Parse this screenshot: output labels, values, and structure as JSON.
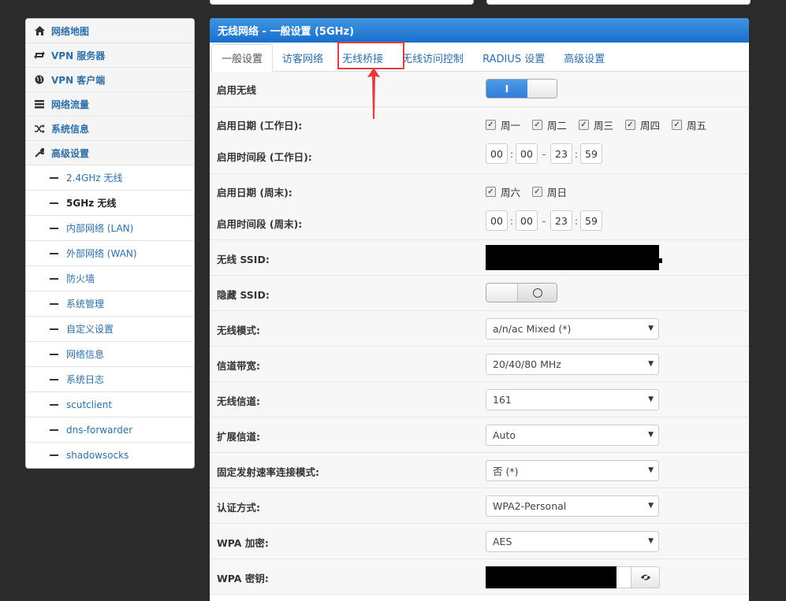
{
  "sidebar": {
    "items": [
      {
        "label": "网络地图",
        "icon": "home-icon"
      },
      {
        "label": "VPN 服务器",
        "icon": "vpn-server-icon"
      },
      {
        "label": "VPN 客户端",
        "icon": "globe-icon"
      },
      {
        "label": "网络流量",
        "icon": "list-icon"
      },
      {
        "label": "系统信息",
        "icon": "shuffle-icon"
      },
      {
        "label": "高级设置",
        "icon": "wrench-icon"
      }
    ],
    "subitems": [
      {
        "label": "2.4GHz 无线"
      },
      {
        "label": "5GHz 无线"
      },
      {
        "label": "内部网络 (LAN)"
      },
      {
        "label": "外部网络 (WAN)"
      },
      {
        "label": "防火墙"
      },
      {
        "label": "系统管理"
      },
      {
        "label": "自定义设置"
      },
      {
        "label": "网络信息"
      },
      {
        "label": "系统日志"
      },
      {
        "label": "scutclient"
      },
      {
        "label": "dns-forwarder"
      },
      {
        "label": "shadowsocks"
      }
    ],
    "active_subitem": "5GHz 无线"
  },
  "panel": {
    "title": "无线网络 - 一般设置 (5GHz)",
    "tabs": [
      "一般设置",
      "访客网络",
      "无线桥接",
      "无线访问控制",
      "RADIUS 设置",
      "高级设置"
    ],
    "active_tab": "一般设置",
    "highlighted_tab": "无线桥接"
  },
  "form": {
    "enable_wireless": {
      "label": "启用无线",
      "state": "on",
      "on_text": "I"
    },
    "weekday_days": {
      "label": "启用日期 (工作日):",
      "days": [
        "周一",
        "周二",
        "周三",
        "周四",
        "周五"
      ],
      "checked": true
    },
    "weekday_time": {
      "label": "启用时间段 (工作日):",
      "start_h": "00",
      "start_m": "00",
      "end_h": "23",
      "end_m": "59",
      "sep": ":",
      "range_sep": "-"
    },
    "weekend_days": {
      "label": "启用日期 (周末):",
      "days": [
        "周六",
        "周日"
      ],
      "checked": true
    },
    "weekend_time": {
      "label": "启用时间段 (周末):",
      "start_h": "00",
      "start_m": "00",
      "end_h": "23",
      "end_m": "59"
    },
    "ssid": {
      "label": "无线 SSID:"
    },
    "hide_ssid": {
      "label": "隐藏 SSID:",
      "state": "off"
    },
    "mode": {
      "label": "无线模式:",
      "value": "a/n/ac Mixed (*)"
    },
    "bandwidth": {
      "label": "信道带宽:",
      "value": "20/40/80 MHz"
    },
    "channel": {
      "label": "无线信道:",
      "value": "161"
    },
    "ext_channel": {
      "label": "扩展信道:",
      "value": "Auto"
    },
    "fixed_rate": {
      "label": "固定发射速率连接模式:",
      "value": "否 (*)"
    },
    "auth": {
      "label": "认证方式:",
      "value": "WPA2-Personal"
    },
    "wpa_enc": {
      "label": "WPA 加密:",
      "value": "AES"
    },
    "wpa_key": {
      "label": "WPA 密钥:"
    }
  },
  "colors": {
    "header": "#1a6fcc",
    "link": "#2d6fa8",
    "annotation": "#e53b3b",
    "background": "#2b2b2b"
  }
}
